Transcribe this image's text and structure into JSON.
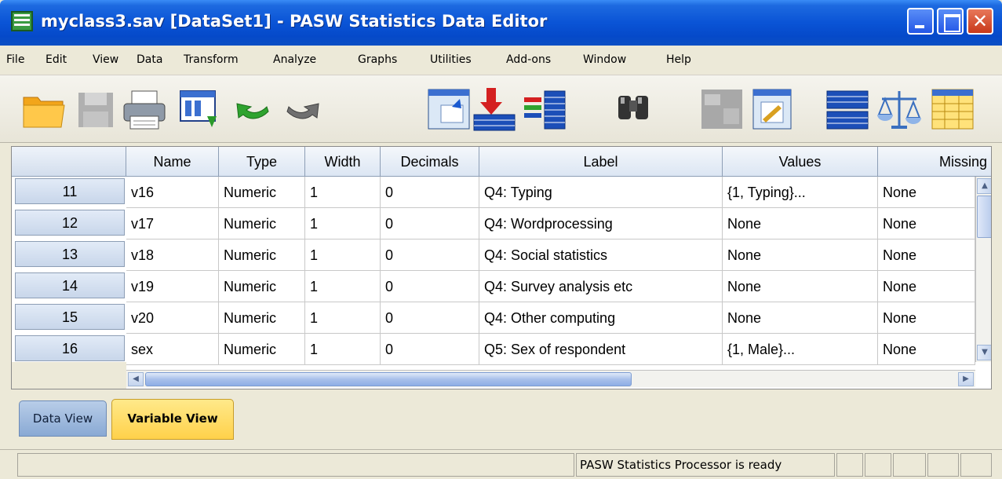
{
  "window": {
    "title": "myclass3.sav [DataSet1] - PASW Statistics Data Editor",
    "close_glyph": "✕"
  },
  "menu": [
    "File",
    "Edit",
    "View",
    "Data",
    "Transform",
    "Analyze",
    "Graphs",
    "Utilities",
    "Add-ons",
    "Window",
    "Help"
  ],
  "toolbar": {
    "buttons": [
      {
        "name": "open-data-icon"
      },
      {
        "name": "save-icon",
        "disabled": true
      },
      {
        "name": "print-icon"
      },
      {
        "name": "dialog-recall-icon"
      },
      {
        "name": "undo-icon"
      },
      {
        "name": "redo-icon"
      },
      {
        "name": "go-to-case-icon"
      },
      {
        "name": "go-to-variable-icon"
      },
      {
        "name": "variables-icon"
      },
      {
        "name": "find-icon"
      },
      {
        "name": "insert-cases-icon",
        "disabled": true
      },
      {
        "name": "insert-variable-icon"
      },
      {
        "name": "split-file-icon"
      },
      {
        "name": "weight-cases-icon"
      },
      {
        "name": "select-cases-icon"
      }
    ]
  },
  "grid": {
    "columns": [
      "Name",
      "Type",
      "Width",
      "Decimals",
      "Label",
      "Values",
      "Missing"
    ],
    "rows": [
      {
        "num": "11",
        "cells": [
          "v16",
          "Numeric",
          "1",
          "0",
          "Q4: Typing",
          "{1, Typing}...",
          "None"
        ]
      },
      {
        "num": "12",
        "cells": [
          "v17",
          "Numeric",
          "1",
          "0",
          "Q4: Wordprocessing",
          "None",
          "None"
        ]
      },
      {
        "num": "13",
        "cells": [
          "v18",
          "Numeric",
          "1",
          "0",
          "Q4: Social statistics",
          "None",
          "None"
        ]
      },
      {
        "num": "14",
        "cells": [
          "v19",
          "Numeric",
          "1",
          "0",
          "Q4: Survey analysis etc",
          "None",
          "None"
        ]
      },
      {
        "num": "15",
        "cells": [
          "v20",
          "Numeric",
          "1",
          "0",
          "Q4: Other computing",
          "None",
          "None"
        ]
      },
      {
        "num": "16",
        "cells": [
          "sex",
          "Numeric",
          "1",
          "0",
          "Q5: Sex of respondent",
          "{1, Male}...",
          "None"
        ]
      }
    ]
  },
  "scroll": {
    "up": "▲",
    "down": "▼",
    "left": "◀",
    "right": "▶"
  },
  "tabs": {
    "data_view": "Data View",
    "variable_view": "Variable View",
    "active": "variable_view"
  },
  "status": {
    "processor": "PASW Statistics Processor is ready"
  }
}
